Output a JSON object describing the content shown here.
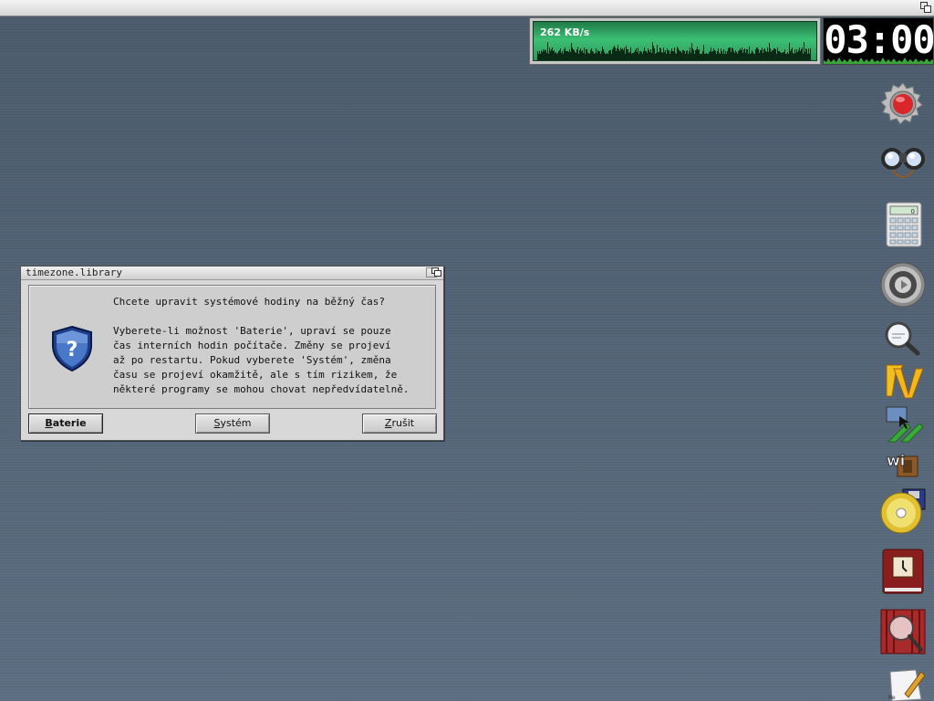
{
  "network": {
    "rate": "262 KB/s"
  },
  "clock": {
    "time": "03:00"
  },
  "dialog": {
    "title": "timezone.library",
    "question": "Chcete upravit systémové hodiny na běžný čas?",
    "body_lines": [
      "Vyberete-li možnost 'Baterie', upraví se pouze",
      "čas interních hodin počítače. Změny se projeví",
      "až po restartu. Pokud vyberete 'Systém', změna",
      "času se projeví okamžitě, ale s tím rizikem, že",
      "některé programy se mohou chovat nepředvídatelně."
    ],
    "buttons": {
      "battery": {
        "key": "B",
        "rest": "aterie"
      },
      "system": {
        "key": "S",
        "rest": "ystém"
      },
      "cancel": {
        "key": "Z",
        "rest": "rušit"
      }
    }
  },
  "dock": {
    "items": [
      "prefs-icon",
      "search-binoculars-icon",
      "calculator-icon",
      "speaker-icon",
      "magnifier-icon",
      "tv-icon",
      "screen-tool-icon",
      "wifi-icon",
      "disk-save-icon",
      "clock-book-icon",
      "image-viewer-icon",
      "text-editor-icon"
    ]
  },
  "colors": {
    "desktop": "#5a6b7c",
    "netmon_green": "#3cbf75",
    "dialog_bg": "#d8d8d8"
  }
}
